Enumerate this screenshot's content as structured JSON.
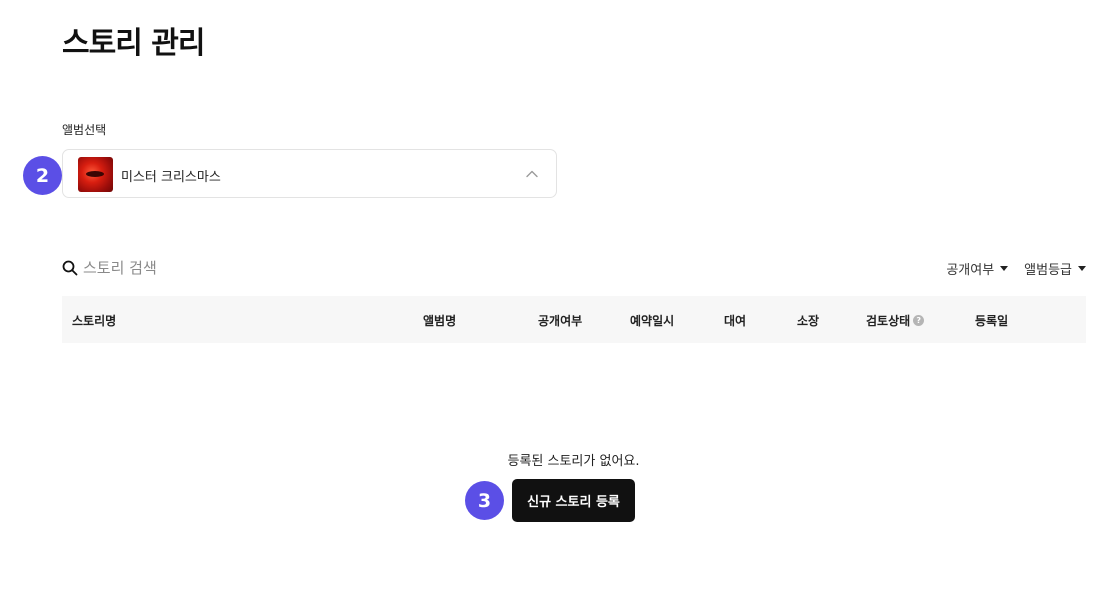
{
  "page": {
    "title": "스토리 관리"
  },
  "album_select": {
    "label": "앨범선택",
    "selected_album": "미스터 크리스마스",
    "step_badge": "2"
  },
  "search": {
    "placeholder": "스토리 검색"
  },
  "filters": [
    {
      "label": "공개여부"
    },
    {
      "label": "앨범등급"
    }
  ],
  "table": {
    "columns": [
      "스토리명",
      "앨범명",
      "공개여부",
      "예약일시",
      "대여",
      "소장",
      "검토상태",
      "등록일"
    ],
    "help_icon": "?"
  },
  "empty_state": {
    "message": "등록된 스토리가 없어요.",
    "button_label": "신규 스토리 등록",
    "step_badge": "3"
  },
  "colors": {
    "accent": "#5b4fe6",
    "button_bg": "#111111",
    "header_bg": "#f7f7f7"
  }
}
